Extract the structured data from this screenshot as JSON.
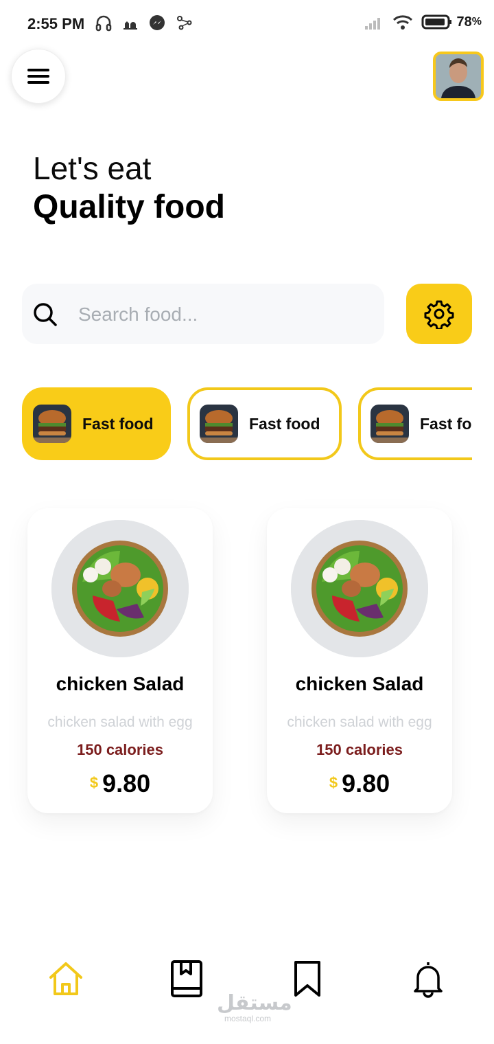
{
  "status": {
    "time": "2:55 PM",
    "battery": "78"
  },
  "header": {
    "menu_icon": "hamburger-icon",
    "avatar": "user-avatar"
  },
  "heading": {
    "line1": "Let's eat",
    "line2": "Quality food"
  },
  "search": {
    "placeholder": "Search food...",
    "filter_icon": "gear-icon"
  },
  "categories": [
    {
      "label": "Fast food",
      "active": true
    },
    {
      "label": "Fast food",
      "active": false
    },
    {
      "label": "Fast food",
      "active": false
    }
  ],
  "foods": [
    {
      "title": "chicken Salad",
      "description": "chicken salad with egg",
      "calories": "150 calories",
      "currency": "$",
      "price": "9.80"
    },
    {
      "title": "chicken Salad",
      "description": "chicken salad with egg",
      "calories": "150 calories",
      "currency": "$",
      "price": "9.80"
    }
  ],
  "nav": {
    "items": [
      "home-icon",
      "book-icon",
      "bookmark-icon",
      "bell-icon"
    ],
    "active": "home-icon"
  },
  "watermark": {
    "arabic": "مستقل",
    "latin": "mostaql.com"
  },
  "colors": {
    "accent": "#f9cc18",
    "calories": "#7b1d1d",
    "placeholder": "#a8adb3"
  }
}
